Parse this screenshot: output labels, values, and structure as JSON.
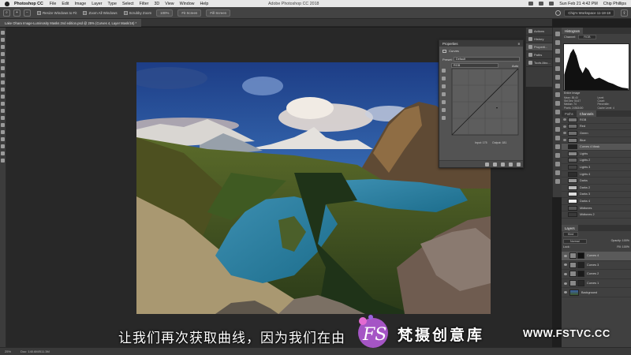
{
  "menubar": {
    "app": "Photoshop CC",
    "items": [
      "File",
      "Edit",
      "Image",
      "Layer",
      "Type",
      "Select",
      "Filter",
      "3D",
      "View",
      "Window",
      "Help"
    ],
    "center_title": "Adobe Photoshop CC 2018",
    "clock": "Sun Feb 21  4:42 PM",
    "user": "Chip Phillips"
  },
  "options_bar": {
    "resize_windows": "Resize Windows to Fit",
    "zoom_all": "Zoom All Windows",
    "scrubby_zoom": "Scrubby Zoom",
    "zoom_level": "100%",
    "fit_screen": "Fit Screen",
    "fill_screen": "Fill Screen",
    "workspace": "Chip's Workspace 11-18-18"
  },
  "document": {
    "tab_title": "Lake Ohara Image-Luminosity Masks 2nd edition.psd @ 25% (Curves 4, Layer Mask/16) *"
  },
  "properties": {
    "title": "Properties",
    "subtitle": "Curves",
    "preset_label": "Preset:",
    "preset_value": "Default",
    "channel_value": "RGB",
    "auto": "Auto",
    "input_label": "Input: 175",
    "output_label": "Output: 181"
  },
  "mini_panels": [
    "Actions",
    "History",
    "Properti...",
    "Paths",
    "Tools Abo..."
  ],
  "histogram": {
    "tabs": [
      "Histogram"
    ],
    "channel_label": "Channel:",
    "channel": "RGB",
    "source": "Entire Image",
    "stats": [
      "Mean: 85.40",
      "Std Dev: 54.67",
      "Median: 74",
      "Pixels: 24563400",
      "Level:",
      "Count:",
      "Percentile:",
      "Cache Level: 4"
    ]
  },
  "channels": {
    "tabs": [
      "Paths",
      "Channels"
    ],
    "rows": [
      "RGB",
      "Red",
      "Green",
      "Blue",
      "Curves 4 Mask",
      "Lights",
      "Lights 2",
      "Lights 3",
      "Lights 4",
      "Darks",
      "Darks 2",
      "Darks 3",
      "Darks 4",
      "Midtones",
      "Midtones 2"
    ]
  },
  "layers": {
    "tab": "Layers",
    "kind": "Kind",
    "blend": "Normal",
    "opacity": "Opacity: 100%",
    "lock": "Lock:",
    "fill": "Fill: 100%",
    "rows": [
      "Curves 4",
      "Curves 3",
      "Curves 2",
      "Curves 1",
      "Background"
    ]
  },
  "status": {
    "zoom": "25%",
    "doc": "Doc: 140.6M/511.3M"
  },
  "subtitle": "让我们再次获取曲线，因为我们在由",
  "watermark": {
    "logo_letters": "FS",
    "title": "梵摄创意库",
    "url": "WWW.FSTVC.CC"
  }
}
